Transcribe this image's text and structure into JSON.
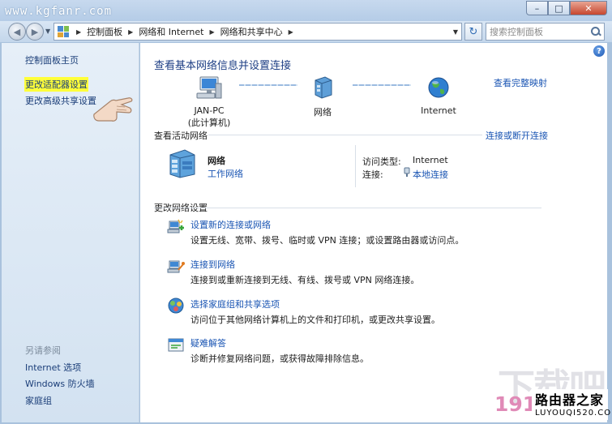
{
  "watermark_top": "www.kgfanr.com",
  "window": {
    "minimize_icon": "minimize-icon",
    "maximize_icon": "maximize-icon",
    "close_icon": "close-icon"
  },
  "address_bar": {
    "crumbs": [
      "控制面板",
      "网络和 Internet",
      "网络和共享中心"
    ],
    "search_placeholder": "搜索控制面板"
  },
  "sidebar": {
    "items": [
      {
        "label": "控制面板主页"
      },
      {
        "label": "更改适配器设置",
        "highlighted": true
      },
      {
        "label": "更改高级共享设置"
      }
    ],
    "see_also_label": "另请参阅",
    "see_also": [
      {
        "label": "Internet 选项"
      },
      {
        "label": "Windows 防火墙"
      },
      {
        "label": "家庭组"
      }
    ]
  },
  "main": {
    "title": "查看基本网络信息并设置连接",
    "full_map_link": "查看完整映射",
    "nodes": [
      {
        "label": "JAN-PC",
        "sublabel": "(此计算机)"
      },
      {
        "label": "网络"
      },
      {
        "label": "Internet"
      }
    ],
    "active_header": "查看活动网络",
    "connect_disconnect": "连接或断开连接",
    "network": {
      "name": "网络",
      "type": "工作网络",
      "access_type_label": "访问类型:",
      "access_type_value": "Internet",
      "connection_label": "连接:",
      "connection_value": "本地连接"
    },
    "change_header": "更改网络设置",
    "tasks": [
      {
        "link": "设置新的连接或网络",
        "desc": "设置无线、宽带、拨号、临时或 VPN 连接；或设置路由器或访问点。"
      },
      {
        "link": "连接到网络",
        "desc": "连接到或重新连接到无线、有线、拨号或 VPN 网络连接。"
      },
      {
        "link": "选择家庭组和共享选项",
        "desc": "访问位于其他网络计算机上的文件和打印机，或更改共享设置。"
      },
      {
        "link": "疑难解答",
        "desc": "诊断并修复网络问题，或获得故障排除信息。"
      }
    ]
  },
  "watermarks": {
    "big": "下载吧",
    "num": "191",
    "brand_cn": "路由器之家",
    "brand_url": "LUYOUQI520.COM"
  },
  "colors": {
    "link": "#1a55b3",
    "title": "#1e3f85",
    "sidebar_bg": "#dde9f5",
    "highlight": "#ffff3a"
  }
}
